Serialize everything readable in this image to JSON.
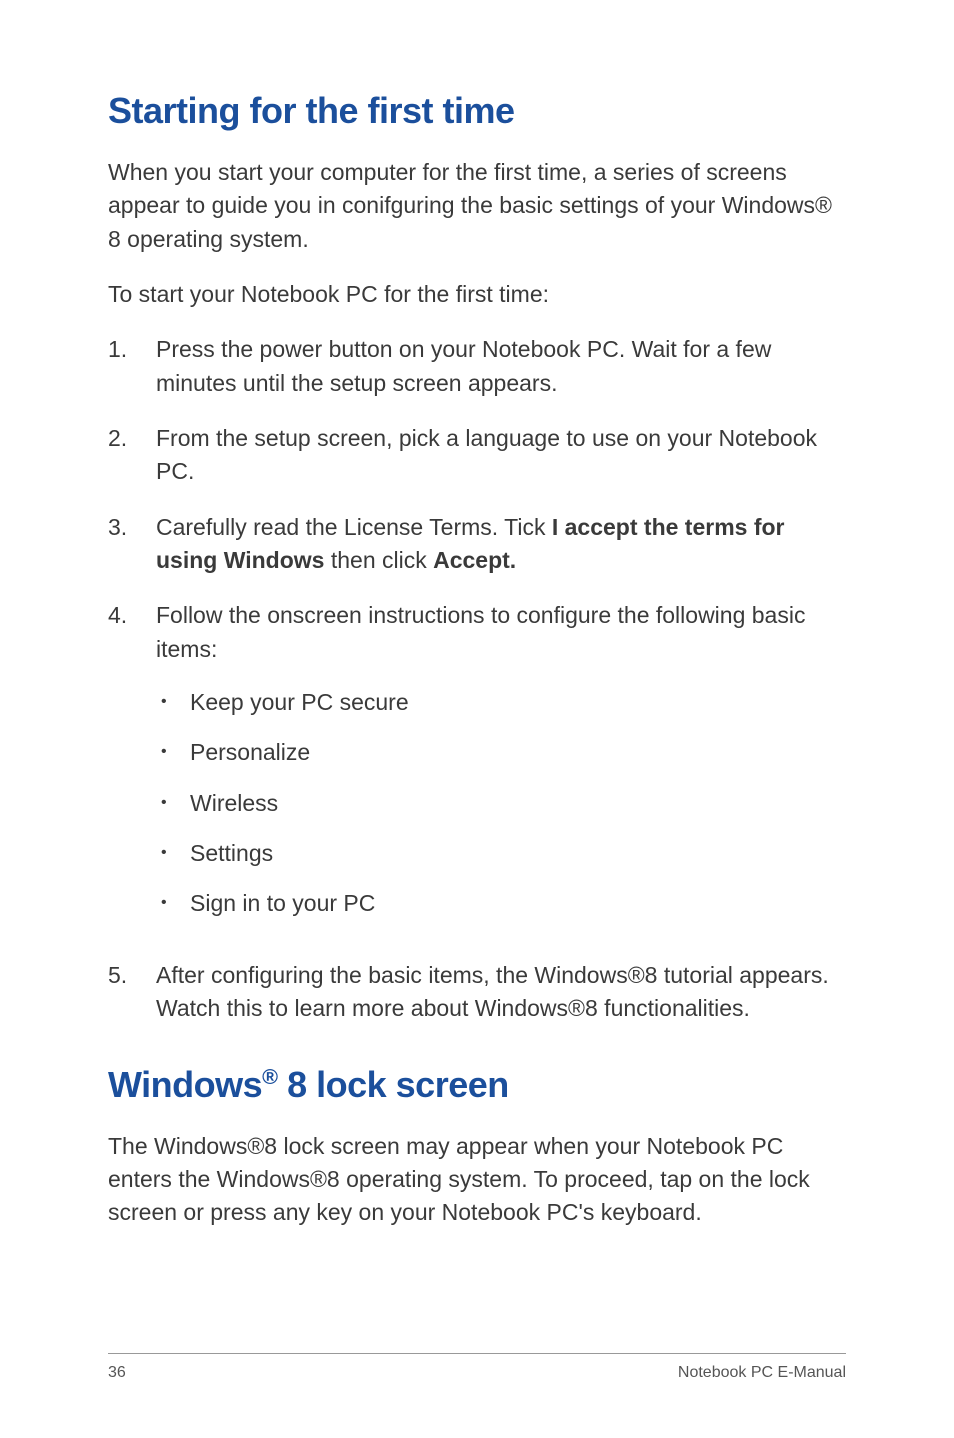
{
  "heading1": "Starting for the first time",
  "intro1_p1": "When you start your computer for the first time, a series of screens appear to guide you in conifguring the basic settings of your Windows® 8 operating system.",
  "intro1_p2": "To start your Notebook PC for the first time:",
  "steps": [
    {
      "num": "1.",
      "text": "Press the power button on your Notebook PC. Wait for a few minutes until the setup screen appears."
    },
    {
      "num": "2.",
      "text": "From the setup screen, pick a language to use on your Notebook PC."
    },
    {
      "num": "3.",
      "prefix": "Carefully read the License Terms. Tick ",
      "bold1": "I accept the terms for using Windows",
      "mid": " then click ",
      "bold2": "Accept."
    },
    {
      "num": "4.",
      "text": "Follow the onscreen instructions to configure the following basic items:"
    },
    {
      "num": "5.",
      "text": "After configuring the basic items, the Windows®8 tutorial appears. Watch this to learn more about Windows®8 functionalities."
    }
  ],
  "bullets": [
    "Keep your PC secure",
    "Personalize",
    "Wireless",
    "Settings",
    "Sign in to your PC"
  ],
  "heading2_pre": "Windows",
  "heading2_sup": "®",
  "heading2_post": " 8 lock screen",
  "intro2": "The Windows®8 lock screen may appear when your Notebook PC enters the Windows®8 operating system. To proceed,  tap on the lock screen or press any key on your Notebook PC's keyboard.",
  "footer": {
    "page": "36",
    "title": "Notebook PC E-Manual"
  }
}
